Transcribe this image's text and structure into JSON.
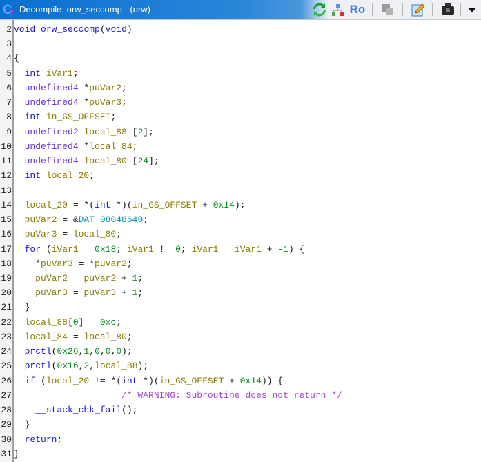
{
  "window": {
    "title": "Decompile: orw_seccomp -  (orw)",
    "icon": "decompile-cf-icon"
  },
  "toolbar": {
    "buttons": [
      {
        "name": "refresh-button",
        "icon": "refresh-icon"
      },
      {
        "name": "graph-button",
        "icon": "graph-icon"
      },
      {
        "name": "read-only-button",
        "icon": "ro-icon",
        "label": "Ro"
      },
      {
        "name": "copy-button",
        "icon": "copy-icon"
      },
      {
        "name": "edit-button",
        "icon": "edit-icon"
      },
      {
        "name": "snapshot-button",
        "icon": "camera-icon"
      },
      {
        "name": "menu-button",
        "icon": "chevron-down-icon"
      }
    ]
  },
  "colors": {
    "keyword": "#1818c8",
    "type": "#6a30d8",
    "variable": "#8c7a00",
    "number": "#089020",
    "global": "#0090b0",
    "function": "#1818e0",
    "comment": "#a048d8"
  },
  "lines": [
    {
      "no": "2",
      "tokens": [
        [
          "void",
          "k"
        ],
        [
          " ",
          "p"
        ],
        [
          "orw_seccomp",
          "f"
        ],
        [
          "(",
          "p"
        ],
        [
          "void",
          "k"
        ],
        [
          ")",
          "p"
        ]
      ]
    },
    {
      "no": "3",
      "tokens": []
    },
    {
      "no": "4",
      "tokens": [
        [
          "{",
          "p"
        ]
      ]
    },
    {
      "no": "5",
      "tokens": [
        [
          "  ",
          "p"
        ],
        [
          "int",
          "k"
        ],
        [
          " ",
          "p"
        ],
        [
          "iVar1",
          "v"
        ],
        [
          ";",
          "p"
        ]
      ]
    },
    {
      "no": "6",
      "tokens": [
        [
          "  ",
          "p"
        ],
        [
          "undefined4",
          "t"
        ],
        [
          " *",
          "p"
        ],
        [
          "puVar2",
          "v"
        ],
        [
          ";",
          "p"
        ]
      ]
    },
    {
      "no": "7",
      "tokens": [
        [
          "  ",
          "p"
        ],
        [
          "undefined4",
          "t"
        ],
        [
          " *",
          "p"
        ],
        [
          "puVar3",
          "v"
        ],
        [
          ";",
          "p"
        ]
      ]
    },
    {
      "no": "8",
      "tokens": [
        [
          "  ",
          "p"
        ],
        [
          "int",
          "k"
        ],
        [
          " ",
          "p"
        ],
        [
          "in_GS_OFFSET",
          "v"
        ],
        [
          ";",
          "p"
        ]
      ]
    },
    {
      "no": "9",
      "tokens": [
        [
          "  ",
          "p"
        ],
        [
          "undefined2",
          "t"
        ],
        [
          " ",
          "p"
        ],
        [
          "local_88",
          "v"
        ],
        [
          " [",
          "p"
        ],
        [
          "2",
          "n"
        ],
        [
          "];",
          "p"
        ]
      ]
    },
    {
      "no": "10",
      "tokens": [
        [
          "  ",
          "p"
        ],
        [
          "undefined4",
          "t"
        ],
        [
          " *",
          "p"
        ],
        [
          "local_84",
          "v"
        ],
        [
          ";",
          "p"
        ]
      ]
    },
    {
      "no": "11",
      "tokens": [
        [
          "  ",
          "p"
        ],
        [
          "undefined4",
          "t"
        ],
        [
          " ",
          "p"
        ],
        [
          "local_80",
          "v"
        ],
        [
          " [",
          "p"
        ],
        [
          "24",
          "n"
        ],
        [
          "];",
          "p"
        ]
      ]
    },
    {
      "no": "12",
      "tokens": [
        [
          "  ",
          "p"
        ],
        [
          "int",
          "k"
        ],
        [
          " ",
          "p"
        ],
        [
          "local_20",
          "v"
        ],
        [
          ";",
          "p"
        ]
      ]
    },
    {
      "no": "13",
      "tokens": []
    },
    {
      "no": "14",
      "tokens": [
        [
          "  ",
          "p"
        ],
        [
          "local_20",
          "v"
        ],
        [
          " = *(",
          "p"
        ],
        [
          "int",
          "k"
        ],
        [
          " *)(",
          "p"
        ],
        [
          "in_GS_OFFSET",
          "v"
        ],
        [
          " + ",
          "p"
        ],
        [
          "0x14",
          "n"
        ],
        [
          ");",
          "p"
        ]
      ]
    },
    {
      "no": "15",
      "tokens": [
        [
          "  ",
          "p"
        ],
        [
          "puVar2",
          "v"
        ],
        [
          " = &",
          "p"
        ],
        [
          "DAT_08048640",
          "g"
        ],
        [
          ";",
          "p"
        ]
      ]
    },
    {
      "no": "16",
      "tokens": [
        [
          "  ",
          "p"
        ],
        [
          "puVar3",
          "v"
        ],
        [
          " = ",
          "p"
        ],
        [
          "local_80",
          "v"
        ],
        [
          ";",
          "p"
        ]
      ]
    },
    {
      "no": "17",
      "tokens": [
        [
          "  ",
          "p"
        ],
        [
          "for",
          "k"
        ],
        [
          " (",
          "p"
        ],
        [
          "iVar1",
          "v"
        ],
        [
          " = ",
          "p"
        ],
        [
          "0x18",
          "n"
        ],
        [
          "; ",
          "p"
        ],
        [
          "iVar1",
          "v"
        ],
        [
          " != ",
          "p"
        ],
        [
          "0",
          "n"
        ],
        [
          "; ",
          "p"
        ],
        [
          "iVar1",
          "v"
        ],
        [
          " = ",
          "p"
        ],
        [
          "iVar1",
          "v"
        ],
        [
          " + ",
          "p"
        ],
        [
          "-1",
          "n"
        ],
        [
          ") {",
          "p"
        ]
      ]
    },
    {
      "no": "18",
      "tokens": [
        [
          "    *",
          "p"
        ],
        [
          "puVar3",
          "v"
        ],
        [
          " = *",
          "p"
        ],
        [
          "puVar2",
          "v"
        ],
        [
          ";",
          "p"
        ]
      ]
    },
    {
      "no": "19",
      "tokens": [
        [
          "    ",
          "p"
        ],
        [
          "puVar2",
          "v"
        ],
        [
          " = ",
          "p"
        ],
        [
          "puVar2",
          "v"
        ],
        [
          " + ",
          "p"
        ],
        [
          "1",
          "n"
        ],
        [
          ";",
          "p"
        ]
      ]
    },
    {
      "no": "20",
      "tokens": [
        [
          "    ",
          "p"
        ],
        [
          "puVar3",
          "v"
        ],
        [
          " = ",
          "p"
        ],
        [
          "puVar3",
          "v"
        ],
        [
          " + ",
          "p"
        ],
        [
          "1",
          "n"
        ],
        [
          ";",
          "p"
        ]
      ]
    },
    {
      "no": "21",
      "tokens": [
        [
          "  }",
          "p"
        ]
      ]
    },
    {
      "no": "22",
      "tokens": [
        [
          "  ",
          "p"
        ],
        [
          "local_88",
          "v"
        ],
        [
          "[",
          "p"
        ],
        [
          "0",
          "n"
        ],
        [
          "] = ",
          "p"
        ],
        [
          "0xc",
          "n"
        ],
        [
          ";",
          "p"
        ]
      ]
    },
    {
      "no": "23",
      "tokens": [
        [
          "  ",
          "p"
        ],
        [
          "local_84",
          "v"
        ],
        [
          " = ",
          "p"
        ],
        [
          "local_80",
          "v"
        ],
        [
          ";",
          "p"
        ]
      ]
    },
    {
      "no": "24",
      "tokens": [
        [
          "  ",
          "p"
        ],
        [
          "prctl",
          "f"
        ],
        [
          "(",
          "p"
        ],
        [
          "0x26",
          "n"
        ],
        [
          ",",
          "p"
        ],
        [
          "1",
          "n"
        ],
        [
          ",",
          "p"
        ],
        [
          "0",
          "n"
        ],
        [
          ",",
          "p"
        ],
        [
          "0",
          "n"
        ],
        [
          ",",
          "p"
        ],
        [
          "0",
          "n"
        ],
        [
          ");",
          "p"
        ]
      ]
    },
    {
      "no": "25",
      "tokens": [
        [
          "  ",
          "p"
        ],
        [
          "prctl",
          "f"
        ],
        [
          "(",
          "p"
        ],
        [
          "0x16",
          "n"
        ],
        [
          ",",
          "p"
        ],
        [
          "2",
          "n"
        ],
        [
          ",",
          "p"
        ],
        [
          "local_88",
          "v"
        ],
        [
          ");",
          "p"
        ]
      ]
    },
    {
      "no": "26",
      "tokens": [
        [
          "  ",
          "p"
        ],
        [
          "if",
          "k"
        ],
        [
          " (",
          "p"
        ],
        [
          "local_20",
          "v"
        ],
        [
          " != *(",
          "p"
        ],
        [
          "int",
          "k"
        ],
        [
          " *)(",
          "p"
        ],
        [
          "in_GS_OFFSET",
          "v"
        ],
        [
          " + ",
          "p"
        ],
        [
          "0x14",
          "n"
        ],
        [
          ")) {",
          "p"
        ]
      ]
    },
    {
      "no": "27",
      "tokens": [
        [
          "                    ",
          "p"
        ],
        [
          "/* WARNING: Subroutine does not return */",
          "c"
        ]
      ]
    },
    {
      "no": "28",
      "tokens": [
        [
          "    ",
          "p"
        ],
        [
          "__stack_chk_fail",
          "f"
        ],
        [
          "();",
          "p"
        ]
      ]
    },
    {
      "no": "29",
      "tokens": [
        [
          "  }",
          "p"
        ]
      ]
    },
    {
      "no": "30",
      "tokens": [
        [
          "  ",
          "p"
        ],
        [
          "return",
          "k"
        ],
        [
          ";",
          "p"
        ]
      ]
    },
    {
      "no": "31",
      "tokens": [
        [
          "}",
          "p"
        ]
      ]
    }
  ]
}
